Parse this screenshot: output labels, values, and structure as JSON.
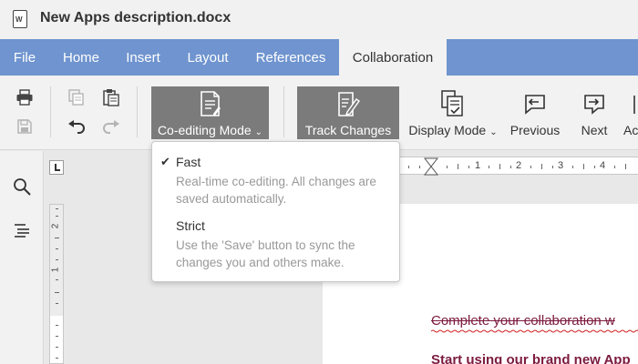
{
  "window": {
    "title": "New Apps description.docx",
    "app_icon": "word-doc-icon",
    "app_icon_letter": "W"
  },
  "menu": {
    "tabs": [
      {
        "label": "File"
      },
      {
        "label": "Home"
      },
      {
        "label": "Insert"
      },
      {
        "label": "Layout"
      },
      {
        "label": "References"
      },
      {
        "label": "Collaboration",
        "active": true
      }
    ]
  },
  "toolbar": {
    "icons": [
      "print-icon",
      "save-icon",
      "copy-icon",
      "paste-icon",
      "undo-icon",
      "redo-icon"
    ],
    "co_editing_label": "Co-editing Mode",
    "track_changes_label": "Track Changes",
    "display_mode_label": "Display Mode",
    "previous_label": "Previous",
    "next_label": "Next",
    "accept_label": "Ac"
  },
  "left_panel": {
    "icons": [
      "search-icon",
      "navigation-icon"
    ]
  },
  "ruler": {
    "h_numbers": [
      "1",
      "2",
      "3",
      "4"
    ],
    "v_numbers": [
      "2",
      "1"
    ]
  },
  "dropdown": {
    "items": [
      {
        "title": "Fast",
        "checked": true,
        "description": "Real-time co-editing. All changes are saved automatically."
      },
      {
        "title": "Strict",
        "checked": false,
        "description": "Use the 'Save' button to sync the changes you and others make."
      }
    ]
  },
  "document": {
    "line1": "Complete your collaboration w",
    "line2": "Start using our brand new App"
  },
  "colors": {
    "menubar": "#6f94cf",
    "pressed_button": "#7b7b7b",
    "doc_text": "#7c1a3e",
    "spell_underline": "#d02020"
  }
}
